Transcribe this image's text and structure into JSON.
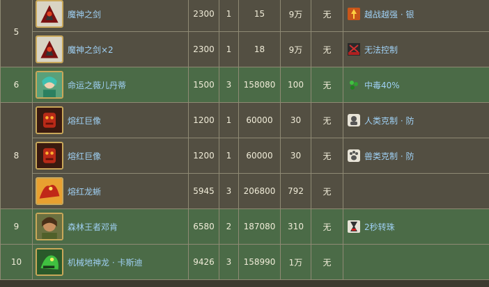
{
  "rows": [
    {
      "stage": "5",
      "name": "魔神之剑",
      "hp": "2300",
      "cd": "1",
      "atk": "15",
      "def": "9万",
      "extra": "无",
      "skill": "越战越强 · 银",
      "portrait": "demon-sword",
      "skill_icon": "rage-up-icon"
    },
    {
      "name": "魔神之剑×2",
      "hp": "2300",
      "cd": "1",
      "atk": "18",
      "def": "9万",
      "extra": "无",
      "skill": "无法控制",
      "portrait": "demon-sword",
      "skill_icon": "stat-disabled-icon"
    },
    {
      "stage": "6",
      "name": "命运之薇儿丹蒂",
      "hp": "1500",
      "cd": "3",
      "atk": "158080",
      "def": "100",
      "extra": "无",
      "skill": "中毒40%",
      "portrait": "verdandi",
      "skill_icon": "poison-icon"
    },
    {
      "stage": "8",
      "name": "熔红巨像",
      "hp": "1200",
      "cd": "1",
      "atk": "60000",
      "def": "30",
      "extra": "无",
      "skill": "人类克制 · 防",
      "portrait": "crimson-golem",
      "skill_icon": "human-fist-icon"
    },
    {
      "name": "熔红巨像",
      "hp": "1200",
      "cd": "1",
      "atk": "60000",
      "def": "30",
      "extra": "无",
      "skill": "兽类克制 · 防",
      "portrait": "crimson-golem",
      "skill_icon": "beast-paw-icon"
    },
    {
      "name": "熔红龙蜥",
      "hp": "5945",
      "cd": "3",
      "atk": "206800",
      "def": "792",
      "extra": "无",
      "skill": "",
      "portrait": "crimson-dragon",
      "skill_icon": ""
    },
    {
      "stage": "9",
      "name": "森林王者邓肯",
      "hp": "6580",
      "cd": "2",
      "atk": "187080",
      "def": "310",
      "extra": "无",
      "skill": "2秒转珠",
      "portrait": "duncan",
      "skill_icon": "hourglass-icon"
    },
    {
      "stage": "10",
      "name": "机械地神龙 · 卡斯迪",
      "hp": "9426",
      "cd": "3",
      "atk": "158990",
      "def": "1万",
      "extra": "无",
      "skill": "",
      "portrait": "mech-dragon",
      "skill_icon": ""
    }
  ],
  "colors": {
    "brown_row": "#534f42",
    "green_row": "#4b6b47",
    "link": "#9fd0f4",
    "border": "#8f8a74"
  }
}
